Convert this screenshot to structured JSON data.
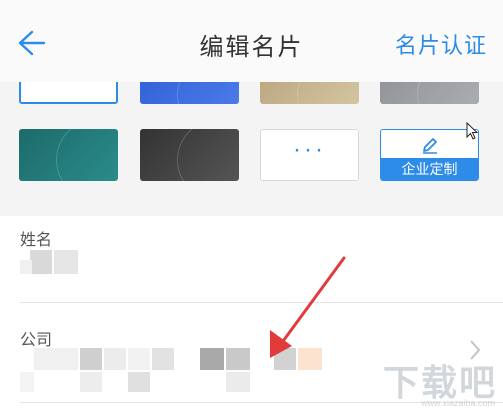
{
  "header": {
    "back_icon": "back-arrow-icon",
    "title": "编辑名片",
    "action_label": "名片认证",
    "accent_color": "#2d8ce8"
  },
  "templates": {
    "items": [
      {
        "name": "white",
        "selected": true
      },
      {
        "name": "blue"
      },
      {
        "name": "gold"
      },
      {
        "name": "gray"
      },
      {
        "name": "teal"
      },
      {
        "name": "dark"
      },
      {
        "name": "more"
      },
      {
        "name": "custom"
      }
    ],
    "more_label": "···",
    "custom_label": "企业定制",
    "custom_icon": "pencil-icon"
  },
  "form": {
    "name_label": "姓名",
    "company_label": "公司"
  },
  "watermark": {
    "main": "下载吧",
    "sub": "www.xiazaiba.com"
  }
}
